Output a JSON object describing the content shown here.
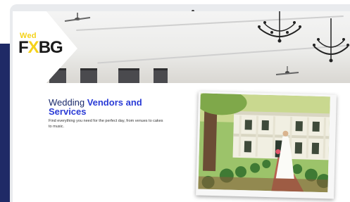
{
  "logo": {
    "top_text": "Wed",
    "main_text_before": "F",
    "main_text_x": "X",
    "main_text_after": "BG"
  },
  "content": {
    "title_regular": "Wedding ",
    "title_bold_line1": "Vendors and",
    "title_bold_line2": "Services",
    "subtitle_line1": "Find everything you need for the perfect day, from venues to cakes",
    "subtitle_line2": "to music."
  },
  "colors": {
    "navy": "#1f2a66",
    "brand_yellow": "#f5d21a",
    "title_blue": "#2a3bd6"
  },
  "icons": {
    "hero": "wedding-venue-interior-image",
    "photo": "bride-outside-venue-photo"
  }
}
